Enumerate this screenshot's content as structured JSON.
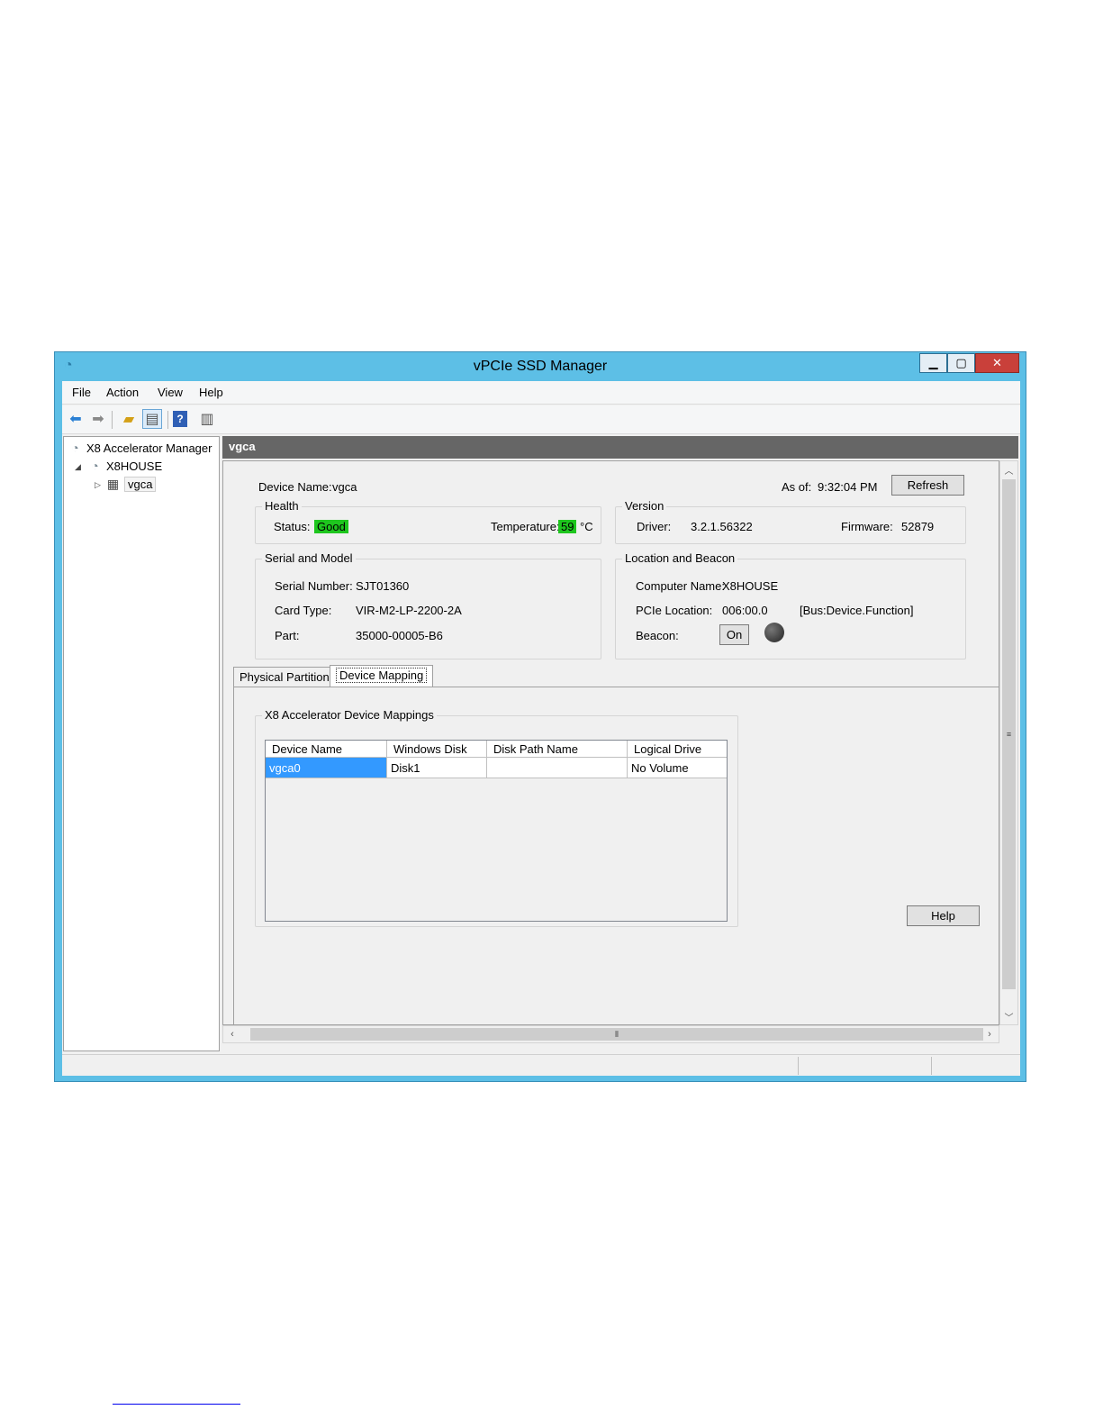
{
  "window": {
    "title": "vPCIe SSD Manager"
  },
  "menu": [
    "File",
    "Action",
    "View",
    "Help"
  ],
  "toolbar": {
    "icons": [
      "back-arrow-icon",
      "forward-arrow-icon",
      "up-folder-icon",
      "show-hide-tree-icon",
      "help-icon",
      "action-pane-icon"
    ]
  },
  "tree": {
    "root": "X8 Accelerator Manager",
    "host": "X8HOUSE",
    "device": "vgca"
  },
  "header": {
    "title": "vgca"
  },
  "device": {
    "name_label": "Device Name:",
    "name_value": "vgca",
    "asof_label": "As of:",
    "asof_value": "9:32:04 PM",
    "refresh_label": "Refresh"
  },
  "health": {
    "title": "Health",
    "status_label": "Status:",
    "status_value": "Good",
    "temp_label": "Temperature:",
    "temp_value": "59",
    "temp_unit": "°C"
  },
  "version": {
    "title": "Version",
    "driver_label": "Driver:",
    "driver_value": "3.2.1.56322",
    "firmware_label": "Firmware:",
    "firmware_value": "52879"
  },
  "serial": {
    "title": "Serial and Model",
    "serial_label": "Serial Number:",
    "serial_value": "SJT01360",
    "card_label": "Card Type:",
    "card_value": "VIR-M2-LP-2200-2A",
    "part_label": "Part:",
    "part_value": "35000-00005-B6"
  },
  "location": {
    "title": "Location and Beacon",
    "computer_label": "Computer Name:",
    "computer_value": "X8HOUSE",
    "pcie_label": "PCIe Location:",
    "pcie_value": "006:00.0",
    "pcie_hint": "[Bus:Device.Function]",
    "beacon_label": "Beacon:",
    "beacon_button": "On"
  },
  "tabs": [
    "Physical Partitions",
    "Device Mapping"
  ],
  "mappings": {
    "title": "X8 Accelerator Device Mappings",
    "columns": [
      "Device Name",
      "Windows Disk",
      "Disk Path Name",
      "Logical Drive"
    ],
    "rows": [
      [
        "vgca0",
        "Disk1",
        "",
        "No Volume"
      ]
    ]
  },
  "help_button": "Help",
  "colors": {
    "title_bar": "#5dbfe6",
    "status_good": "#1ec61e",
    "selection": "#3399ff",
    "close_button": "#c9403a"
  }
}
